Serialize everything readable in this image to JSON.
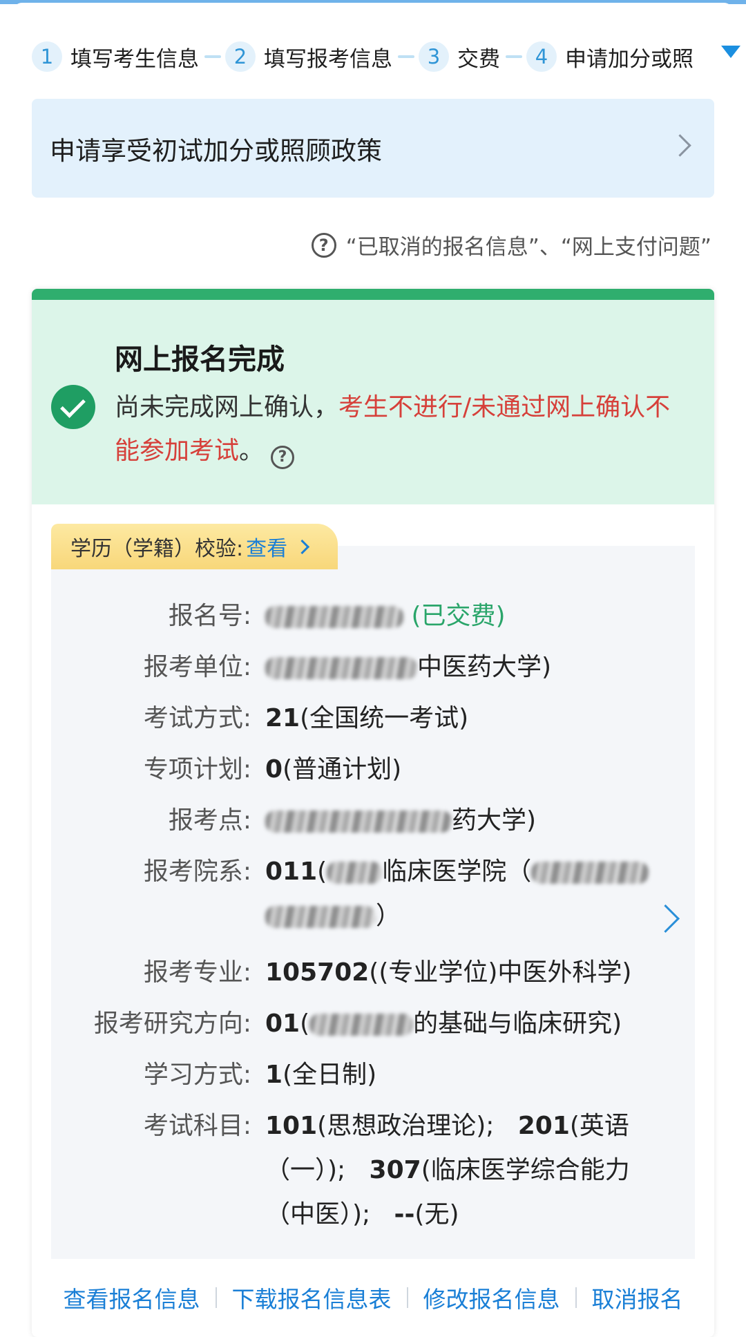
{
  "steps": [
    {
      "num": "1",
      "label": "填写考生信息"
    },
    {
      "num": "2",
      "label": "填写报考信息"
    },
    {
      "num": "3",
      "label": "交费"
    },
    {
      "num": "4",
      "label": "申请加分或照"
    }
  ],
  "policy_banner": {
    "text": "申请享受初试加分或照顾政策"
  },
  "help_links": {
    "text": "“已取消的报名信息”、“网上支付问题”"
  },
  "status": {
    "title": "网上报名完成",
    "desc_normal": "尚未完成网上确认，",
    "desc_warn": "考生不进行/未通过网上确认不能参加考试",
    "desc_end": "。"
  },
  "edu_check": {
    "label": "学历（学籍）校验:",
    "link": "查看"
  },
  "info": {
    "reg_no": {
      "label": "报名号:",
      "status": "(已交费)"
    },
    "unit": {
      "label": "报考单位:",
      "value": "中医药大学)"
    },
    "exam_mode": {
      "label": "考试方式:",
      "code": "21",
      "text": "(全国统一考试)"
    },
    "special_plan": {
      "label": "专项计划:",
      "code": "0",
      "text": "(普通计划)"
    },
    "exam_site": {
      "label": "报考点:",
      "value": "药大学)"
    },
    "department": {
      "label": "报考院系:",
      "code": "011",
      "text": "临床医学院（",
      "tail": "）"
    },
    "major": {
      "label": "报考专业:",
      "code": "105702",
      "text": "((专业学位)中医外科学)"
    },
    "direction": {
      "label": "报考研究方向:",
      "code": "01",
      "text": "的基础与临床研究)"
    },
    "study_mode": {
      "label": "学习方式:",
      "code": "1",
      "text": "(全日制)"
    },
    "subjects": {
      "label": "考试科目:",
      "s1_code": "101",
      "s1_text": "(思想政治理论);",
      "s2_code": "201",
      "s2_text": "(英语（一）);",
      "s3_code": "307",
      "s3_text": "(临床医学综合能力（中医）);",
      "s4_code": "--",
      "s4_text": "(无)"
    }
  },
  "actions": [
    "查看报名信息",
    "下载报名信息表",
    "修改报名信息",
    "取消报名"
  ],
  "colors": {
    "accent": "#1a7fd6",
    "success": "#2fae6e",
    "warning": "#d6403a"
  }
}
